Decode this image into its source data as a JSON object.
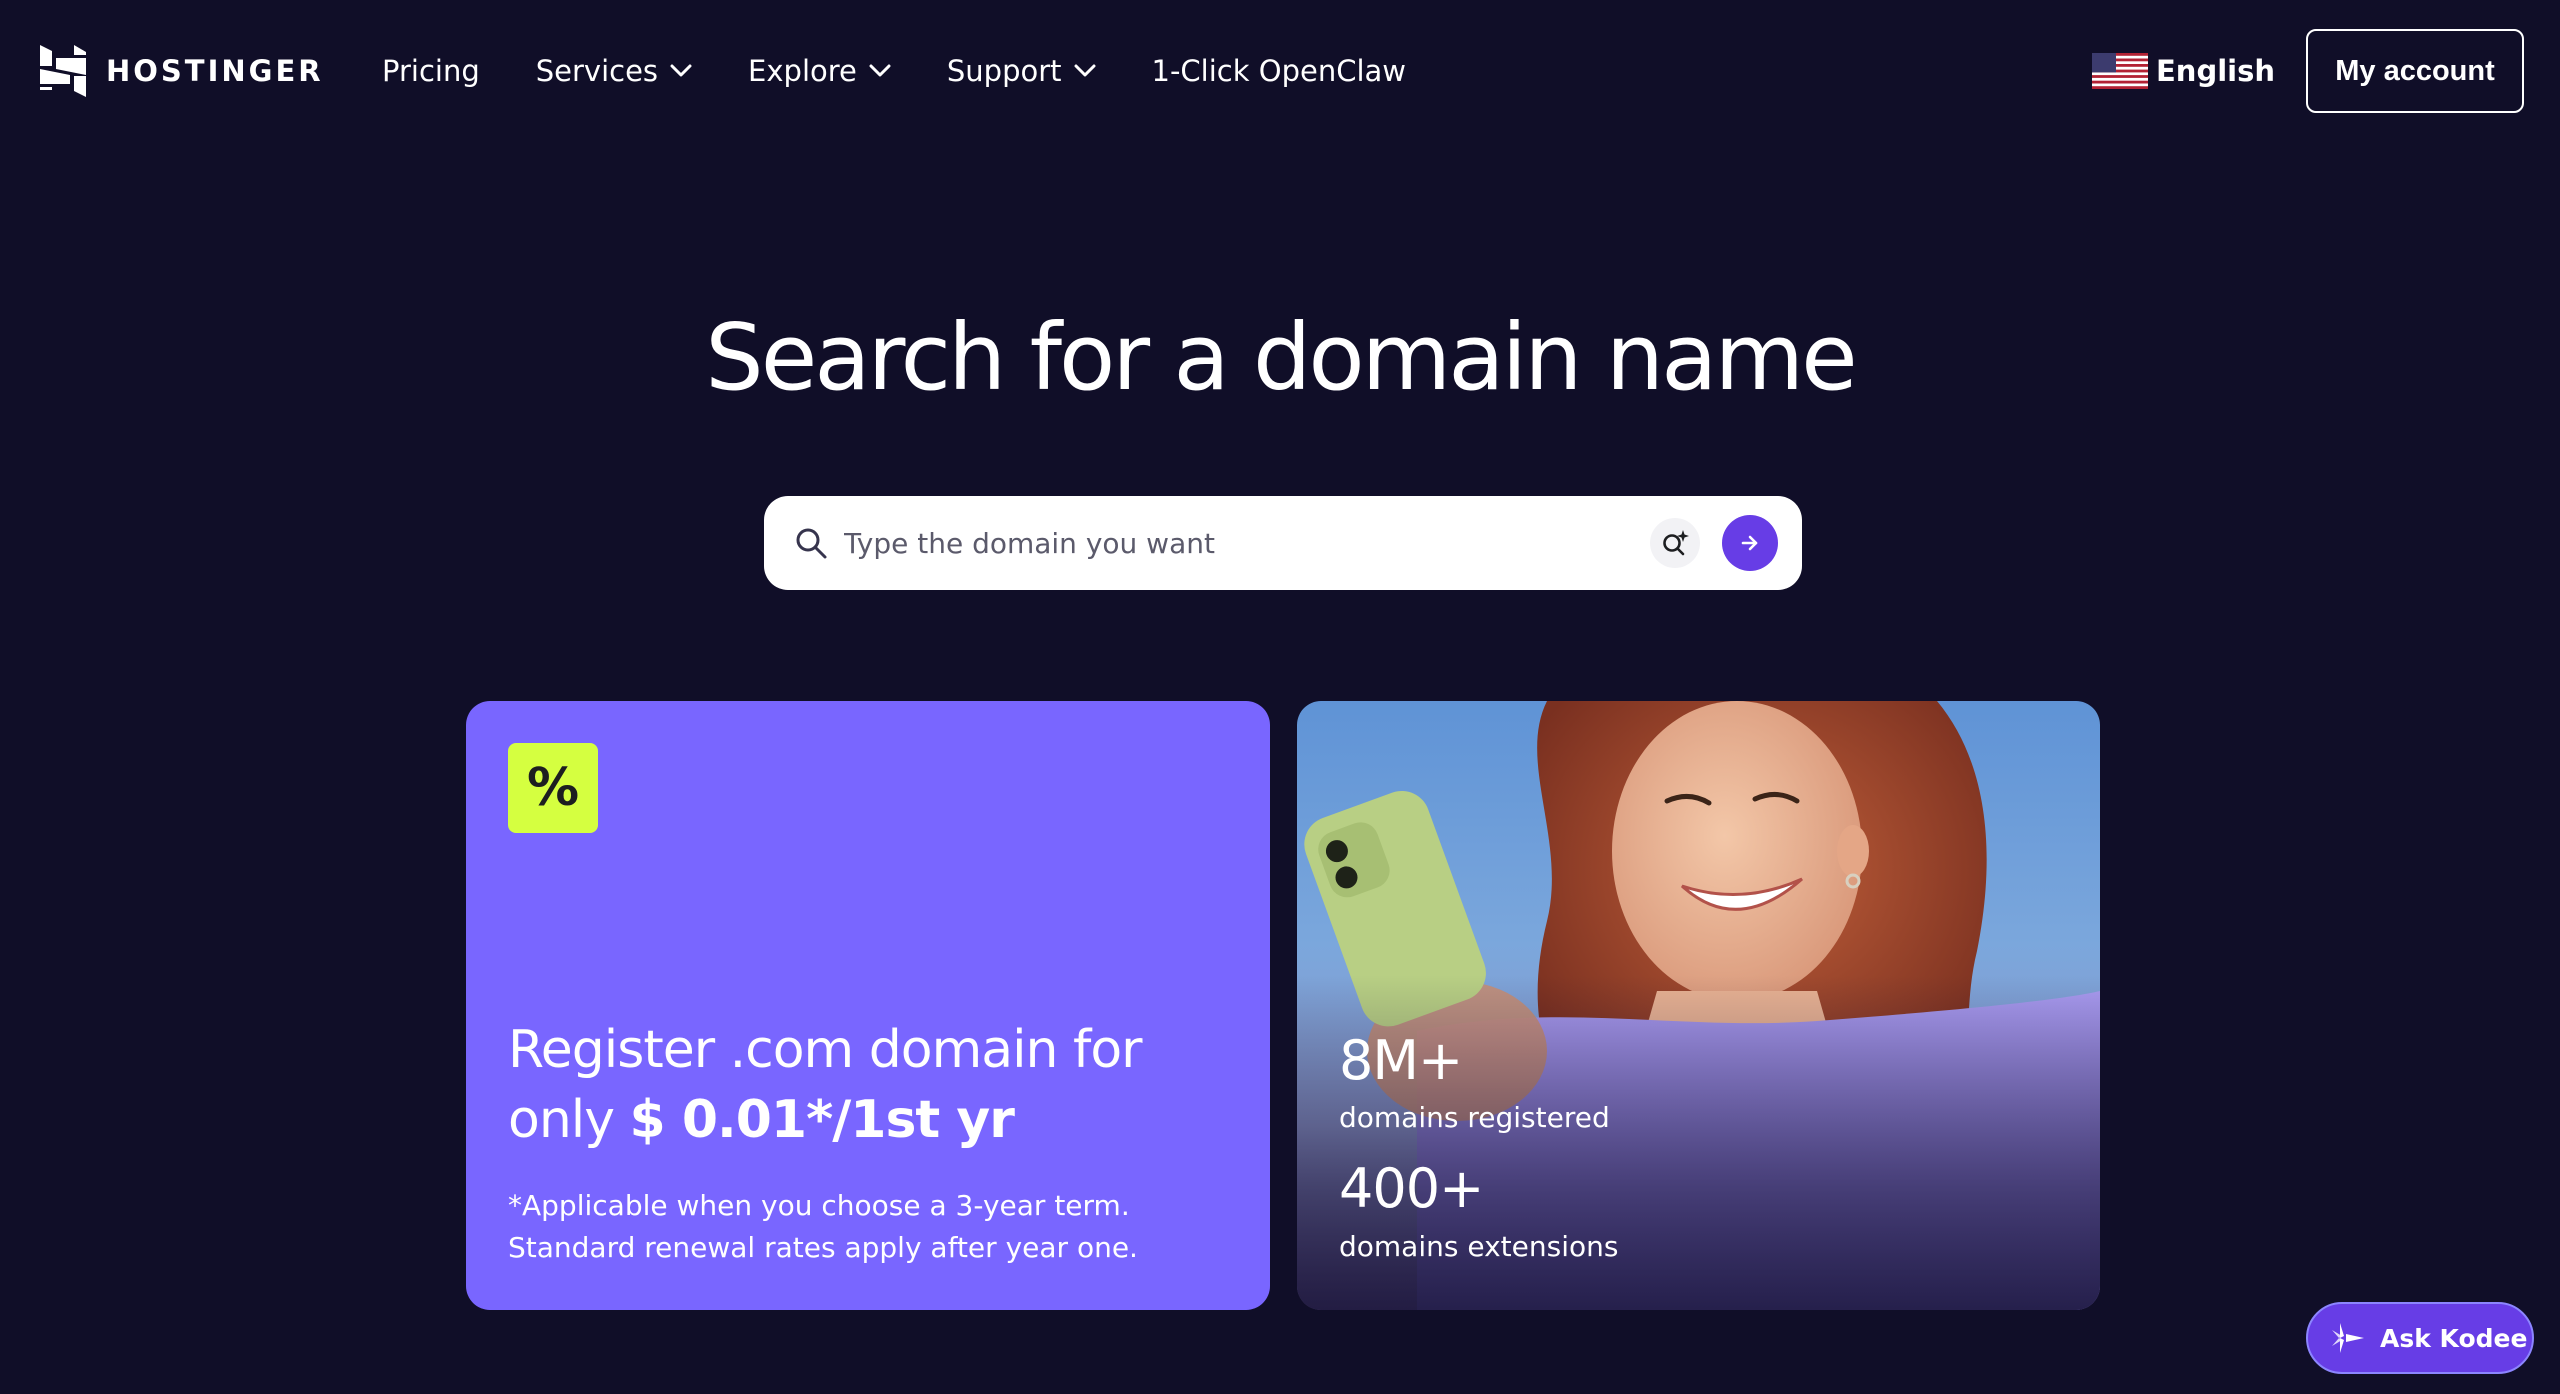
{
  "header": {
    "logo_text": "HOSTINGER",
    "nav": [
      {
        "label": "Pricing",
        "has_dropdown": false
      },
      {
        "label": "Services",
        "has_dropdown": true
      },
      {
        "label": "Explore",
        "has_dropdown": true
      },
      {
        "label": "Support",
        "has_dropdown": true
      },
      {
        "label": "1-Click OpenClaw",
        "has_dropdown": false
      }
    ],
    "language": "English",
    "language_icon": "us-flag-icon",
    "account_button": "My account"
  },
  "hero": {
    "title": "Search for a domain name",
    "search_placeholder": "Type the domain you want",
    "search_value": ""
  },
  "promo_card": {
    "badge": "%",
    "headline_prefix": "Register .com domain for only ",
    "headline_price": "$ 0.01*/1st yr",
    "note": "*Applicable when you choose a 3-year term. Standard renewal rates apply after year one."
  },
  "stats_card": {
    "stats": [
      {
        "value": "8M+",
        "label": "domains registered"
      },
      {
        "value": "400+",
        "label": "domains extensions"
      }
    ]
  },
  "chat": {
    "label": "Ask Kodee",
    "icon": "kodee-sparkle-icon"
  },
  "colors": {
    "background": "#100e28",
    "accent": "#673de6",
    "promo_card": "#7966ff",
    "badge": "#d5ff40"
  }
}
